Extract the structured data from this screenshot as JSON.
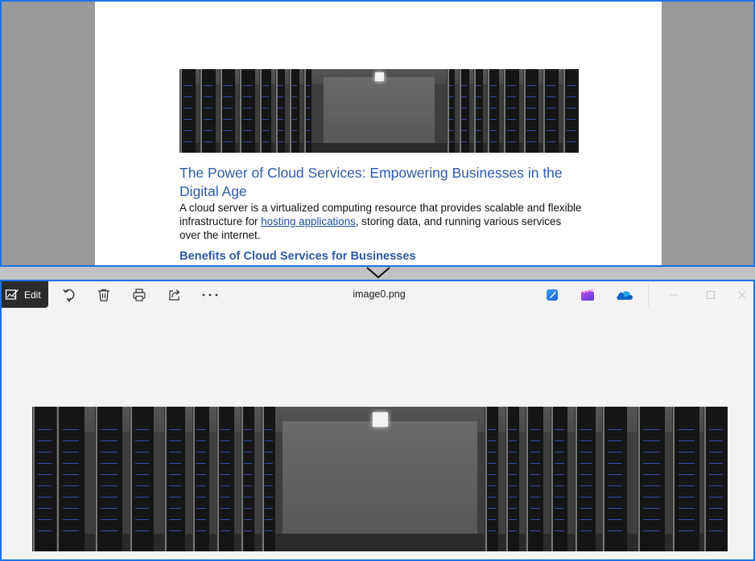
{
  "document": {
    "title": "The Power of Cloud Services: Empowering Businesses in the Digital Age",
    "paragraph_before_link": "A cloud server is a virtualized computing resource that provides scalable and flexible infrastructure for ",
    "link_text": "hosting applications",
    "paragraph_after_link": ", storing data, and running various services over the internet.",
    "subheading": "Benefits of Cloud Services for Businesses",
    "hero_image_icon": "server-room-image"
  },
  "viewer": {
    "edit_label": "Edit",
    "file_name": "image0.png",
    "toolbar_icons": [
      "edit-icon",
      "rotate-icon",
      "delete-icon",
      "print-icon",
      "share-icon",
      "more-icon",
      "designer-icon",
      "clipchamp-icon",
      "onedrive-icon",
      "minimize-icon",
      "maximize-icon",
      "close-icon"
    ],
    "hero_image_icon": "server-room-image"
  },
  "colors": {
    "accent_border": "#1a73e8",
    "heading_blue": "#2e5aa6",
    "toolbar_dark": "#2b2b2b",
    "viewer_background": "#f3f3f3"
  }
}
